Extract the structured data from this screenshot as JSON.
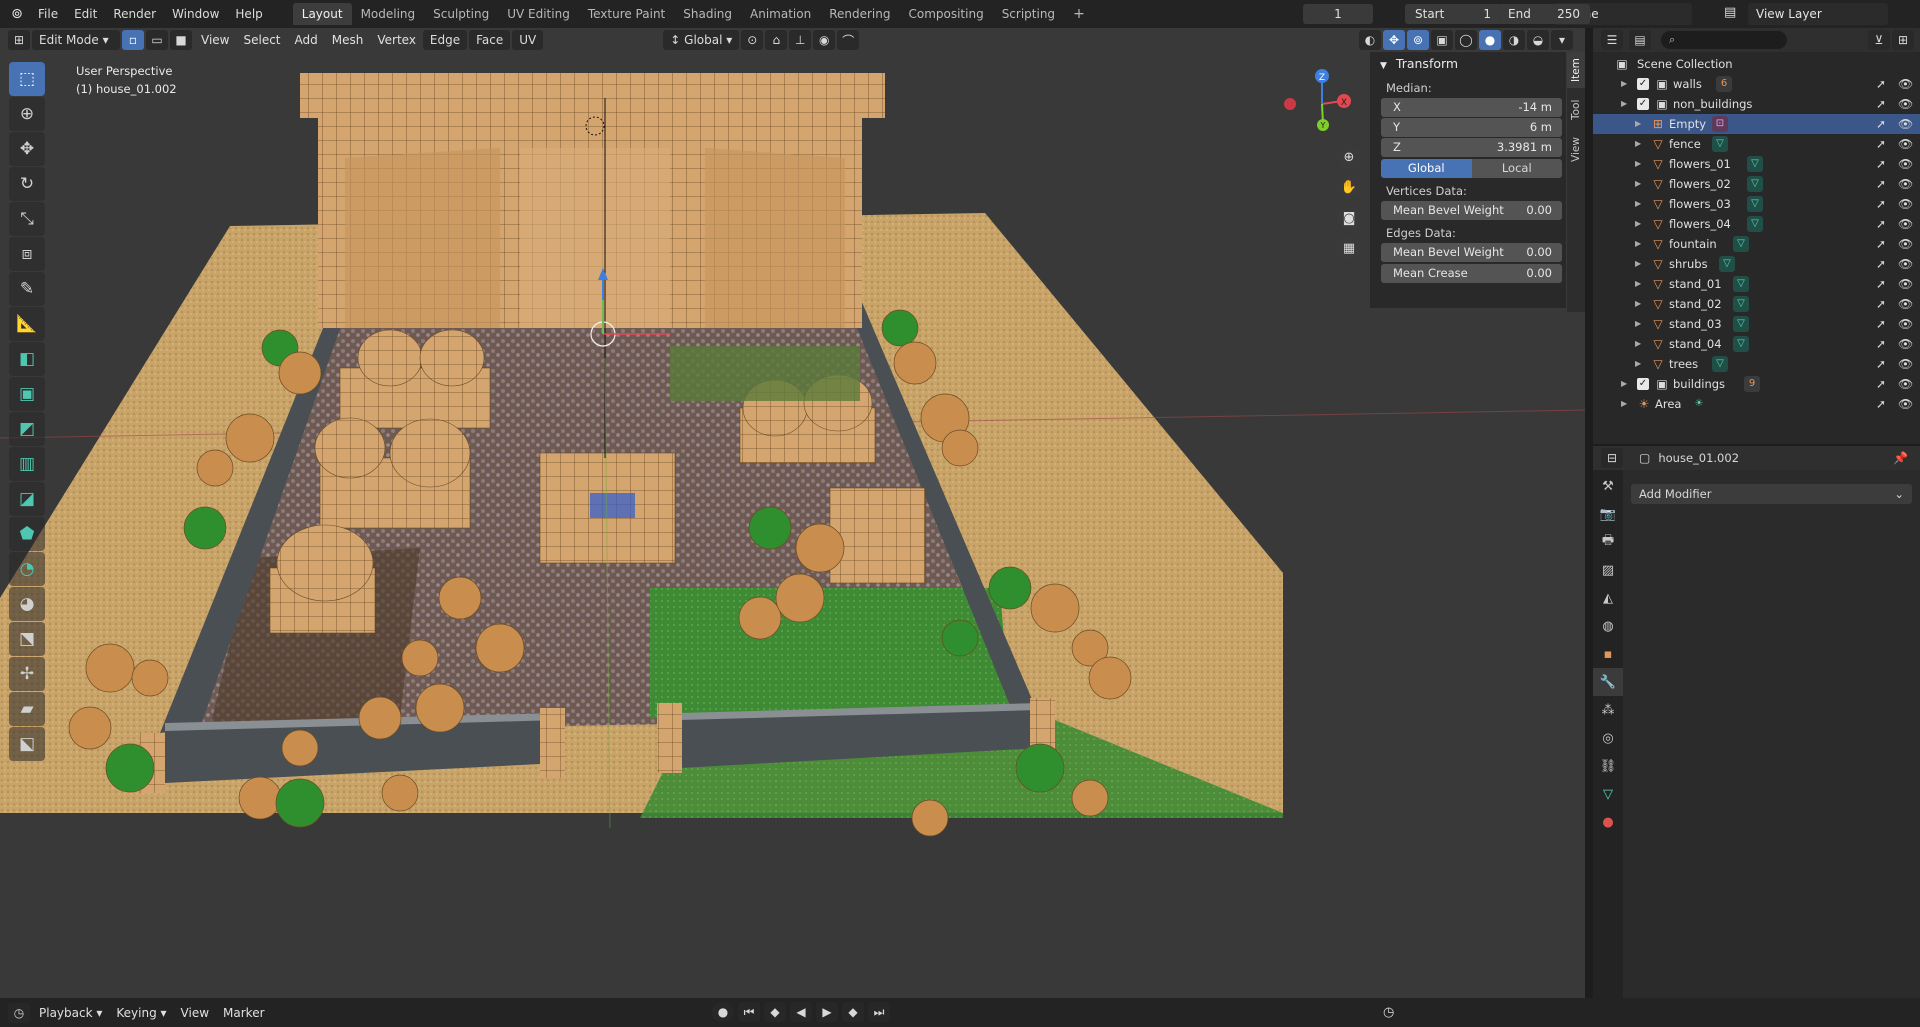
{
  "app": {
    "menus": [
      "File",
      "Edit",
      "Render",
      "Window",
      "Help"
    ],
    "workspaces": [
      "Layout",
      "Modeling",
      "Sculpting",
      "UV Editing",
      "Texture Paint",
      "Shading",
      "Animation",
      "Rendering",
      "Compositing",
      "Scripting"
    ],
    "active_workspace": "Layout",
    "add_workspace": "+",
    "scene": "Scene",
    "view_layer": "View Layer"
  },
  "viewport": {
    "mode": "Edit Mode",
    "menus": [
      "View",
      "Select",
      "Add",
      "Mesh",
      "Vertex",
      "Edge",
      "Face",
      "UV"
    ],
    "orientation": "Global",
    "overlay_title": "User Perspective",
    "overlay_object": "(1) house_01.002",
    "gizmo_axes": {
      "x": "X",
      "y": "Y",
      "z": "Z"
    }
  },
  "npanel": {
    "title": "Transform",
    "median_label": "Median:",
    "fields": [
      {
        "axis": "X",
        "value": "-14 m"
      },
      {
        "axis": "Y",
        "value": "6 m"
      },
      {
        "axis": "Z",
        "value": "3.3981 m"
      }
    ],
    "toggle": [
      "Global",
      "Local"
    ],
    "vertices_label": "Vertices Data:",
    "vertices_fields": [
      {
        "label": "Mean Bevel Weight",
        "value": "0.00"
      }
    ],
    "edges_label": "Edges Data:",
    "edges_fields": [
      {
        "label": "Mean Bevel Weight",
        "value": "0.00"
      },
      {
        "label": "Mean Crease",
        "value": "0.00"
      }
    ],
    "tabs": [
      "Item",
      "Tool",
      "View"
    ]
  },
  "outliner": {
    "root": "Scene Collection",
    "rows": [
      {
        "name": "walls",
        "badge": "6"
      },
      {
        "name": "non_buildings",
        "badge": ""
      },
      {
        "name": "Empty",
        "badge": ""
      },
      {
        "name": "fence",
        "badge": ""
      },
      {
        "name": "flowers_01",
        "badge": ""
      },
      {
        "name": "flowers_02",
        "badge": ""
      },
      {
        "name": "flowers_03",
        "badge": ""
      },
      {
        "name": "flowers_04",
        "badge": ""
      },
      {
        "name": "fountain",
        "badge": ""
      },
      {
        "name": "shrubs",
        "badge": ""
      },
      {
        "name": "stand_01",
        "badge": ""
      },
      {
        "name": "stand_02",
        "badge": ""
      },
      {
        "name": "stand_03",
        "badge": ""
      },
      {
        "name": "stand_04",
        "badge": ""
      },
      {
        "name": "trees",
        "badge": ""
      },
      {
        "name": "buildings",
        "badge": "9"
      },
      {
        "name": "Area",
        "badge": ""
      }
    ]
  },
  "properties": {
    "object_name": "house_01.002",
    "add_modifier": "Add Modifier"
  },
  "timeline": {
    "menus": [
      "Playback",
      "Keying",
      "View",
      "Marker"
    ],
    "current_frame": "1",
    "start_label": "Start",
    "start": "1",
    "end_label": "End",
    "end": "250"
  },
  "colors": {
    "accent": "#4772b3",
    "selection": "#3b5689",
    "object_orange": "#e4965a",
    "mesh_teal": "#5fd3b7"
  }
}
